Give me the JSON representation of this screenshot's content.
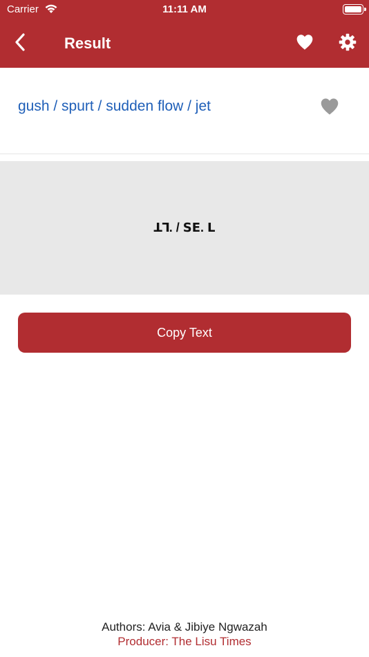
{
  "status_bar": {
    "carrier": "Carrier",
    "time": "11:11 AM"
  },
  "nav": {
    "title": "Result",
    "icons": [
      "chevron-left-icon",
      "heart-icon",
      "gear-icon"
    ]
  },
  "result": {
    "english": "gush / spurt / sudden flow / jet",
    "translation": "ꓕꓶ. / ꓢꓰ. ꓡ"
  },
  "actions": {
    "copy_label": "Copy Text"
  },
  "footer": {
    "authors": "Authors: Avia & Jibiye Ngwazah",
    "producer": "Producer: The Lisu Times"
  },
  "colors": {
    "brand_red": "#b12d31",
    "link_blue": "#1f5fb8",
    "panel_gray": "#e8e8e8",
    "favorite_inactive": "#9a9a9a"
  }
}
